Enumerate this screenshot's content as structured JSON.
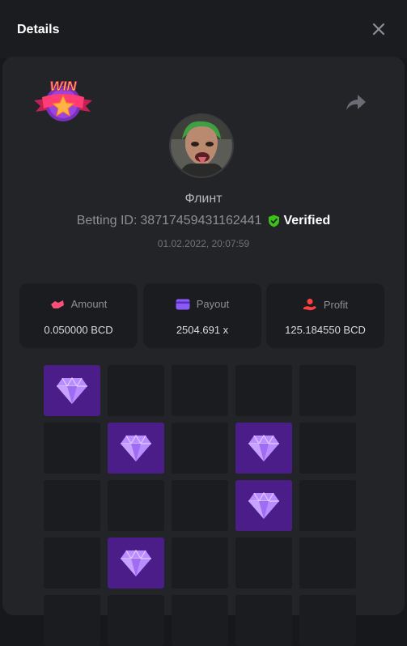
{
  "header": {
    "title": "Details"
  },
  "bet": {
    "username": "Флинт",
    "betting_id_label": "Betting ID:",
    "betting_id": "38717459431162441",
    "verified_label": "Verified",
    "timestamp": "01.02.2022, 20:07:59"
  },
  "badge": {
    "text": "WIN"
  },
  "stats": [
    {
      "label": "Amount",
      "value": "0.050000 BCD",
      "icon": "amount-icon"
    },
    {
      "label": "Payout",
      "value": "2504.691 x",
      "icon": "wallet-icon"
    },
    {
      "label": "Profit",
      "value": "125.184550 BCD",
      "icon": "profit-icon"
    }
  ],
  "colors": {
    "accent_purple": "#4a1d88",
    "gem": "#b98cff",
    "verified_green": "#3bc117",
    "amount_icon": "#ff4e7a",
    "payout_icon": "#8a5cf5",
    "profit_icon": "#ff4040"
  },
  "mines_grid": {
    "columns": 5,
    "rows": [
      [
        true,
        false,
        false,
        false,
        false
      ],
      [
        false,
        true,
        false,
        true,
        false
      ],
      [
        false,
        false,
        false,
        true,
        false
      ],
      [
        false,
        true,
        false,
        false,
        false
      ],
      [
        false,
        false,
        false,
        false,
        false
      ]
    ]
  }
}
